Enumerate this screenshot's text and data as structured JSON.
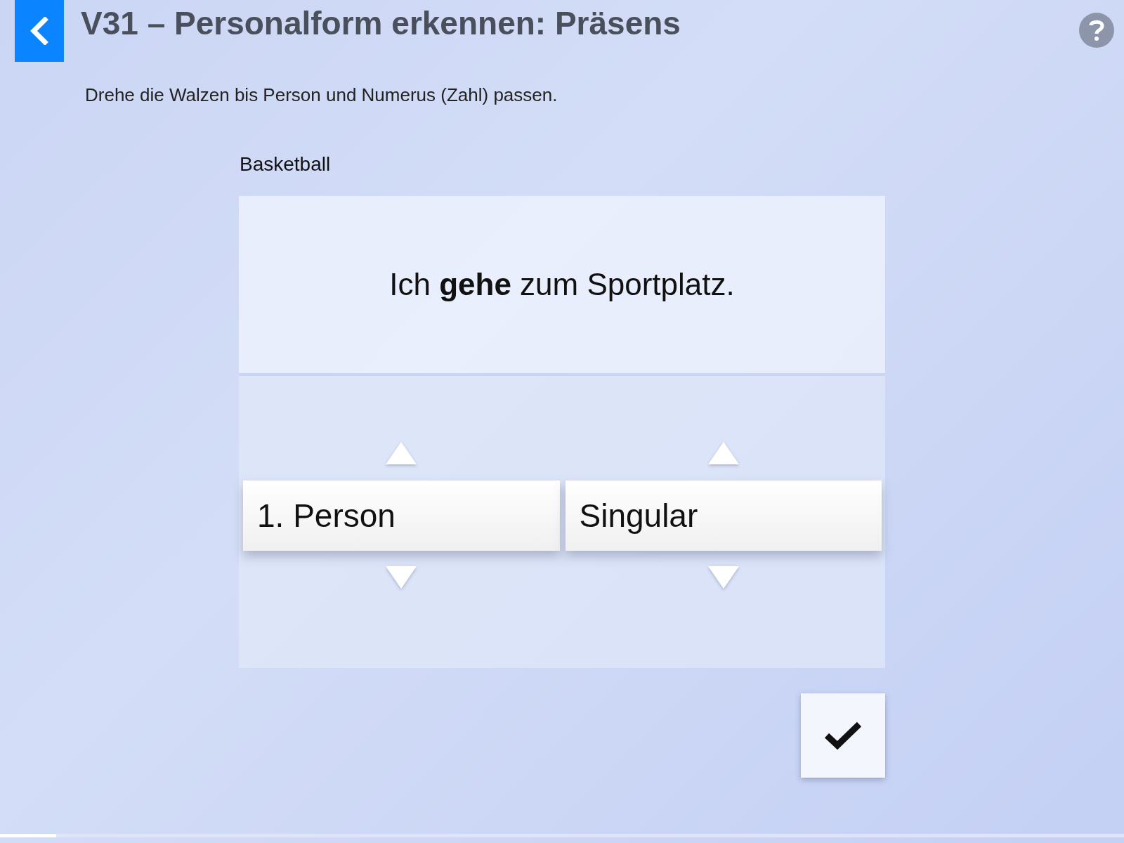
{
  "header": {
    "title": "V31 – Personalform erkennen: Präsens",
    "instruction": "Drehe die Walzen bis Person und Numerus (Zahl) passen."
  },
  "task": {
    "label": "Basketball",
    "sentence": "Ich **gehe** zum Sportplatz."
  },
  "reels": [
    {
      "value": "1. Person"
    },
    {
      "value": "Singular"
    }
  ],
  "progress": {
    "level": 0.05
  }
}
